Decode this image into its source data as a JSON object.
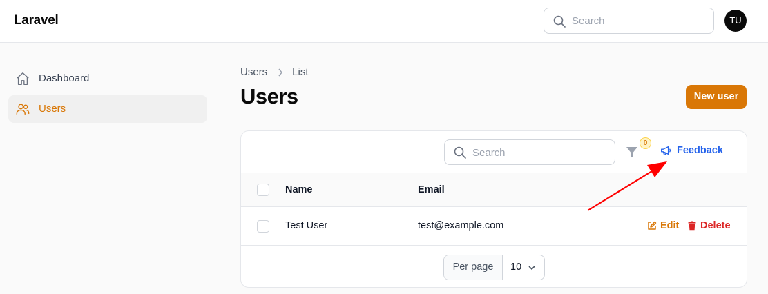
{
  "app": {
    "brand": "Laravel"
  },
  "topbar": {
    "search_placeholder": "Search",
    "avatar_initials": "TU"
  },
  "sidebar": {
    "items": [
      {
        "label": "Dashboard",
        "icon": "home-icon",
        "active": false
      },
      {
        "label": "Users",
        "icon": "users-icon",
        "active": true
      }
    ]
  },
  "breadcrumb": {
    "items": [
      "Users",
      "List"
    ]
  },
  "page": {
    "title": "Users",
    "new_button_label": "New user"
  },
  "table": {
    "search_placeholder": "Search",
    "filter_count": "0",
    "feedback_label": "Feedback",
    "columns": [
      "Name",
      "Email"
    ],
    "rows": [
      {
        "name": "Test User",
        "email": "test@example.com",
        "actions": [
          "Edit",
          "Delete"
        ]
      }
    ],
    "pagination": {
      "per_page_label": "Per page",
      "per_page_value": "10"
    }
  },
  "colors": {
    "accent": "#d97706",
    "link": "#2563eb",
    "danger": "#dc2626",
    "annotation_arrow": "#ff0000"
  }
}
